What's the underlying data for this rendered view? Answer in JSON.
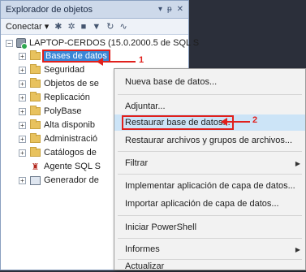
{
  "panel": {
    "title": "Explorador de objetos",
    "controls": {
      "dropdown": "▾",
      "pin": "ᵽ",
      "close": "✕"
    },
    "toolbar": {
      "connect_label": "Conectar",
      "connect_arrow": "▾"
    }
  },
  "tree": {
    "server": "LAPTOP-CERDOS (15.0.2000.5 de SQL S",
    "items": [
      {
        "label": "Bases de datos"
      },
      {
        "label": "Seguridad"
      },
      {
        "label": "Objetos de se"
      },
      {
        "label": "Replicación"
      },
      {
        "label": "PolyBase"
      },
      {
        "label": "Alta disponib"
      },
      {
        "label": "Administració"
      },
      {
        "label": "Catálogos de"
      },
      {
        "label": "Agente SQL S"
      },
      {
        "label": "Generador de"
      }
    ],
    "expand_glyph": "+",
    "collapse_glyph": "−"
  },
  "annotations": {
    "step1": "1",
    "step2": "2"
  },
  "context_menu": {
    "items": [
      {
        "label": "Nueva base de datos..."
      },
      {
        "label": "Adjuntar..."
      },
      {
        "label": "Restaurar base de datos..."
      },
      {
        "label": "Restaurar archivos y grupos de archivos..."
      },
      {
        "label": "Filtrar"
      },
      {
        "label": "Implementar aplicación de capa de datos..."
      },
      {
        "label": "Importar aplicación de capa de datos..."
      },
      {
        "label": "Iniciar PowerShell"
      },
      {
        "label": "Informes"
      },
      {
        "label": "Actualizar"
      }
    ],
    "submenu_glyph": "▶"
  },
  "colors": {
    "selection": "#3a86d6",
    "callout": "#e0201c",
    "menu_highlight": "#cce4f7",
    "folder": "#e8c25e"
  }
}
